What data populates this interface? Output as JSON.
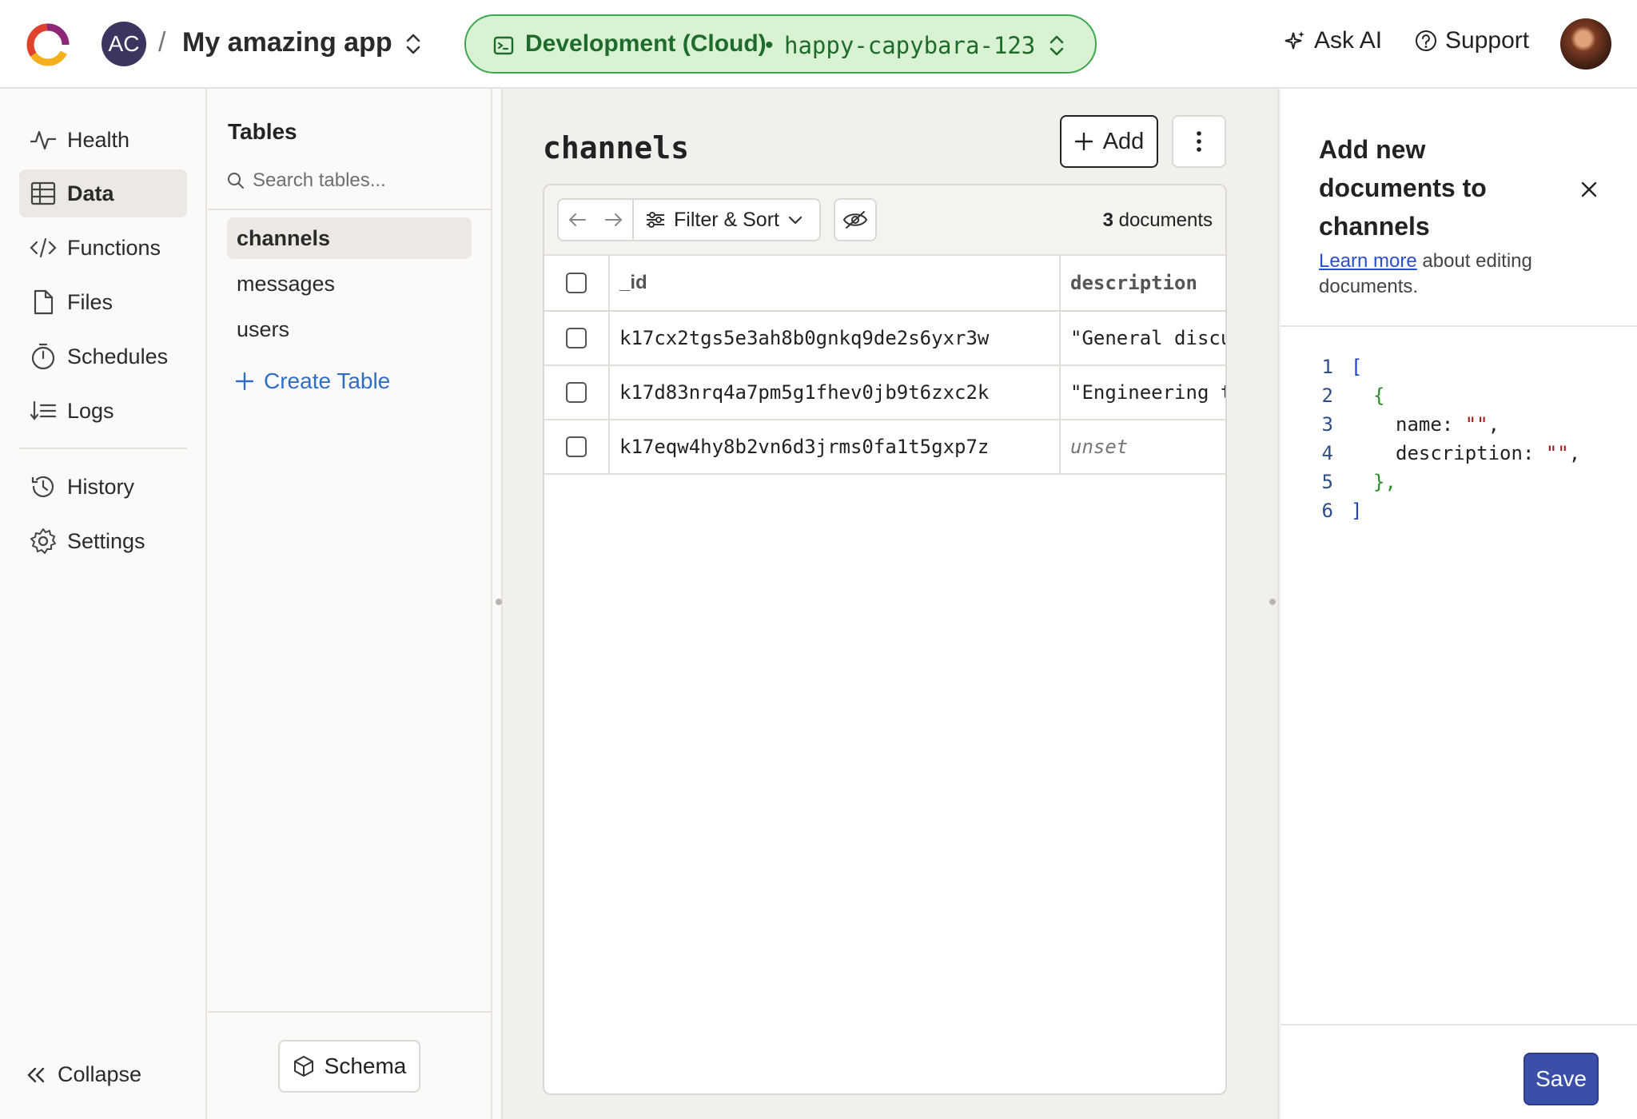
{
  "header": {
    "team_initials": "AC",
    "separator": "/",
    "project_name": "My amazing app",
    "deployment": {
      "name": "Development (Cloud)",
      "dot": "•",
      "slug": "happy-capybara-123",
      "color": "#3ea64f"
    },
    "ask_ai_label": "Ask AI",
    "support_label": "Support"
  },
  "nav": {
    "items": [
      {
        "label": "Health",
        "icon": "health-icon"
      },
      {
        "label": "Data",
        "icon": "table-icon",
        "active": true
      },
      {
        "label": "Functions",
        "icon": "code-icon"
      },
      {
        "label": "Files",
        "icon": "file-icon"
      },
      {
        "label": "Schedules",
        "icon": "timer-icon"
      },
      {
        "label": "Logs",
        "icon": "logs-icon"
      },
      {
        "label": "History",
        "icon": "history-icon"
      },
      {
        "label": "Settings",
        "icon": "gear-icon"
      }
    ],
    "collapse_label": "Collapse"
  },
  "tables": {
    "title": "Tables",
    "search_placeholder": "Search tables...",
    "items": [
      "channels",
      "messages",
      "users"
    ],
    "create_label": "Create Table",
    "schema_label": "Schema"
  },
  "main": {
    "title": "channels",
    "add_label": "Add",
    "filter_sort_label": "Filter & Sort",
    "doc_count": "3",
    "doc_count_suffix": "documents",
    "columns": [
      "_id",
      "description"
    ],
    "rows": [
      {
        "id": "k17cx2tgs5e3ah8b0gnkq9de2s6yxr3w",
        "description": "\"General discussion\""
      },
      {
        "id": "k17d83nrq4a7pm5g1fhev0jb9t6zxc2k",
        "description": "\"Engineering team\""
      },
      {
        "id": "k17eqw4hy8b2vn6d3jrms0fa1t5gxp7z",
        "description": "unset"
      }
    ]
  },
  "panel": {
    "title": "Add new documents to channels",
    "learn_more": "Learn more",
    "learn_rest": " about editing documents.",
    "code_lines": [
      {
        "n": "1",
        "text": "["
      },
      {
        "n": "2",
        "text": "{"
      },
      {
        "n": "3",
        "key": "name: ",
        "value": "\"\"",
        "tail": ","
      },
      {
        "n": "4",
        "key": "description: ",
        "value": "\"\"",
        "tail": ","
      },
      {
        "n": "5",
        "text": "},"
      },
      {
        "n": "6",
        "text": "]"
      }
    ],
    "save_label": "Save",
    "accent_color": "#3b4ea8"
  }
}
